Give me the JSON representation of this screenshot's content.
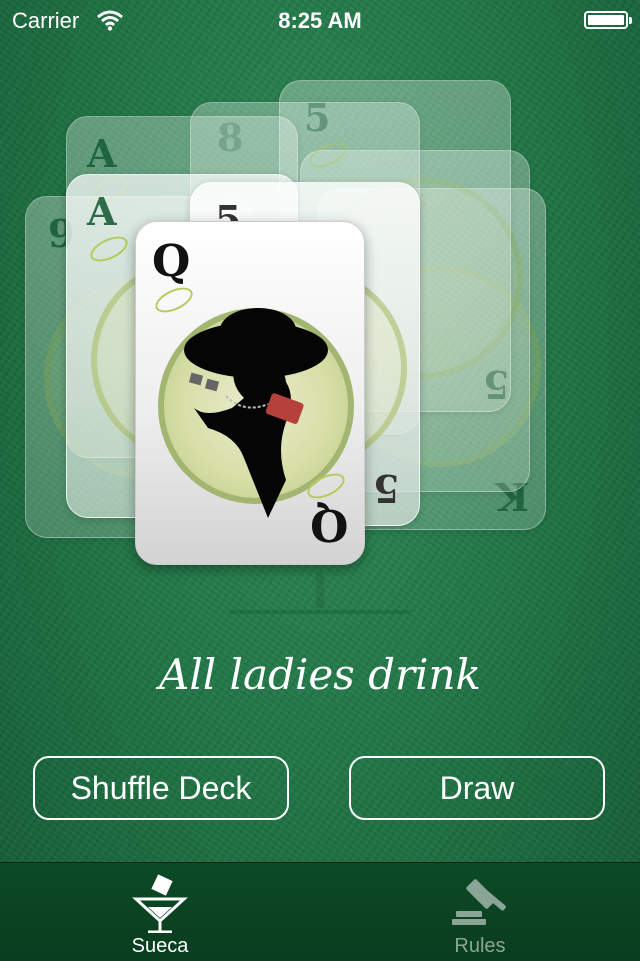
{
  "status_bar": {
    "carrier": "Carrier",
    "time": "8:25 AM"
  },
  "deck": {
    "front_card": {
      "rank": "Q"
    },
    "back_cards": [
      {
        "rank": "A"
      },
      {
        "rank": "8"
      },
      {
        "rank": "5"
      },
      {
        "rank": "A"
      },
      {
        "rank": "9"
      },
      {
        "rank": "5"
      }
    ],
    "side_card": {
      "rank_bottom": "5",
      "rank_k": "K"
    }
  },
  "message": "All ladies drink",
  "buttons": {
    "shuffle": "Shuffle Deck",
    "draw": "Draw"
  },
  "tabs": [
    {
      "label": "Sueca",
      "icon": "cocktail-glass-icon",
      "selected": true
    },
    {
      "label": "Rules",
      "icon": "gavel-icon",
      "selected": false
    }
  ],
  "colors": {
    "felt": "#1f7344",
    "tab_bar": "#0a3d1f",
    "tab_inactive": "#8aa595"
  }
}
